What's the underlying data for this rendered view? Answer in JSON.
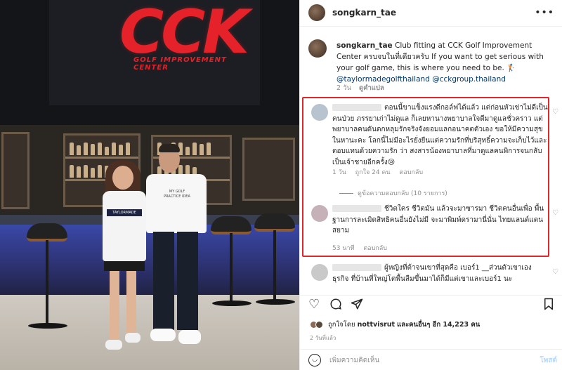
{
  "photo": {
    "logo_text": "CCK",
    "logo_subtitle": "GOLF IMPROVEMENT CENTER",
    "shirt_left_text": "TAYLORMADE",
    "shirt_right_text": "MY GOLF PRACTICE IDEA"
  },
  "header": {
    "username": "songkarn_tae",
    "more_icon": "more-horizontal-icon"
  },
  "caption": {
    "username": "songkarn_tae",
    "text": "Club fitting at CCK Golf Improvement Center ครบจบในที่เดียวครับ If you want to get serious with your golf game, this is where you need to be. 🏌️",
    "mention1": "@taylormadegolfthailand",
    "mention2": "@cckgroup.thailand",
    "time": "2 วัน",
    "translate": "ดูคำแปล"
  },
  "comments": [
    {
      "text": "ตอนนี้ขาแข็งแรงดีกอล์ฟได้แล้ว แต่ก่อนหัวเข่าไม่ดีเป็นคนป่วย ภรรยาเก่าไม่ดูแล ก็เลยหานางพยาบาลใจดีมาดูแลชั่วคราว แต่พยาบาลคนดันตกหลุมรักจริงจังยอมแลกอนาคตตัวเอง ขอให้มีความสุขในหานะคะ โลกนี้ไม่มีอะไรยั่งยืนแต่ความรักที่บริสุทธิ์ความจะเก็บไว้และตอบแทนด้วยความรัก ว่า สงสารน้องพยาบาลที่มาดูแลคนพิการจนกลับเป็นเจ้าชายอีกครั้ง😢",
      "time": "1 วัน",
      "likes": "ถูกใจ 24 คน",
      "reply": "ตอบกลับ",
      "view_replies": "ดูข้อความตอบกลับ (10 รายการ)"
    },
    {
      "text": "ชีวิตใคร ชีวิตมัน แล้วจะมาซารมา ชีวิตคนอื่นเพื่อ พื้นฐานการละเมิดสิทธิคนอื่นยังไม่มี จะมาพิมพ์ดรามานี่นั่น ไทยแลนด์แดนสยาม",
      "time": "53 นาที",
      "reply": "ตอบกลับ"
    },
    {
      "text": "ผู้หญิงที่ต้าจนเขาที่สุดคือ เบอร์1 __ส่วนตัวเขาเอง ธุรกิจ ที่บ้านที่ใหญ่โตพื้นลืมขึ้นมาได้ก็มีแต่เขาและเบอร์1 นะ"
    }
  ],
  "actions": {
    "like_icon": "heart-icon",
    "comment_icon": "comment-icon",
    "share_icon": "send-icon",
    "save_icon": "bookmark-icon"
  },
  "likes": {
    "prefix": "ถูกใจโดย",
    "user": "nottvisrut",
    "suffix": "และคนอื่นๆ อีก 14,223 คน"
  },
  "post_time": "2 วันที่แล้ว",
  "add_comment": {
    "placeholder": "เพิ่มความคิดเห็น",
    "post_label": "โพสต์"
  },
  "colors": {
    "highlight": "#e0252b",
    "link": "#00376b",
    "post_button": "#b3dbff"
  }
}
